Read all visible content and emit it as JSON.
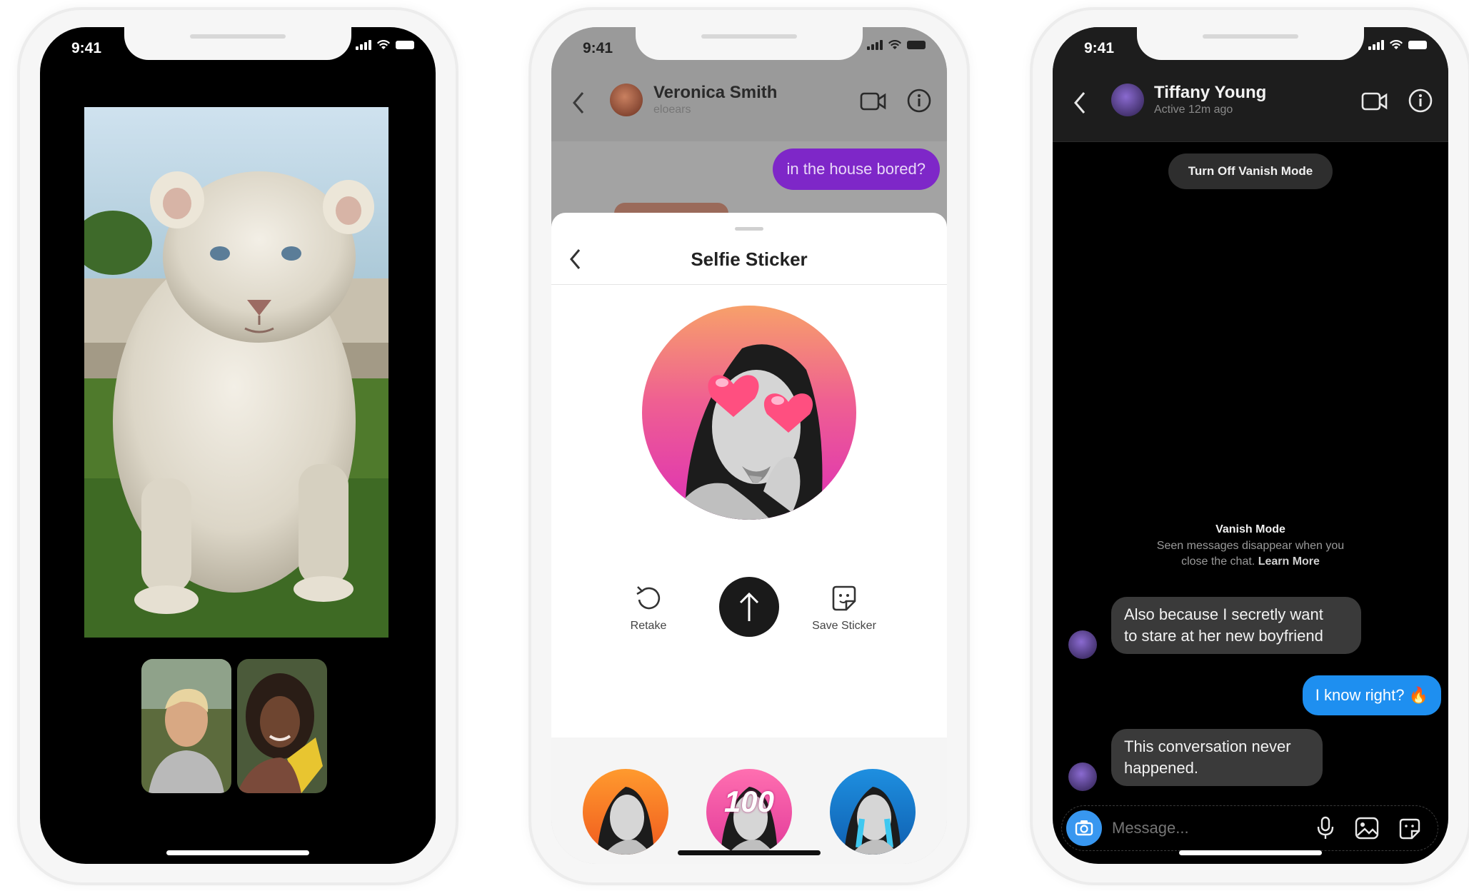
{
  "status_time": "9:41",
  "phone1": {
    "main_image": "white-lion-cub-photo",
    "thumbs": [
      "participant-1-photo",
      "participant-2-photo"
    ]
  },
  "phone2": {
    "contact_name": "Veronica Smith",
    "contact_username": "eloears",
    "sent_message": "in the house bored?",
    "sheet_title": "Selfie Sticker",
    "retake_label": "Retake",
    "save_label": "Save Sticker",
    "sticker_text": "100",
    "colors": {
      "sent_bubble": "#8a2be2",
      "sticker_gradient_top": "#f7a56a",
      "sticker_gradient_bottom": "#e23aa8"
    }
  },
  "phone3": {
    "contact_name": "Tiffany Young",
    "contact_status": "Active 12m ago",
    "vanish_button": "Turn Off Vanish Mode",
    "vanish_title": "Vanish Mode",
    "vanish_desc_line1": "Seen messages disappear when you",
    "vanish_desc_line2": "close the chat.",
    "vanish_link": "Learn More",
    "received_1_line1": "Also because I secretly want",
    "received_1_line2": "to stare at her new boyfriend",
    "sent_1": "I know right? 🔥",
    "received_2_line1": "This conversation never",
    "received_2_line2": "happened.",
    "composer_placeholder": "Message...",
    "colors": {
      "sent_bubble": "#1e8ff0",
      "received_bubble": "#3a3a3a",
      "camera_button": "#3897f0"
    }
  }
}
